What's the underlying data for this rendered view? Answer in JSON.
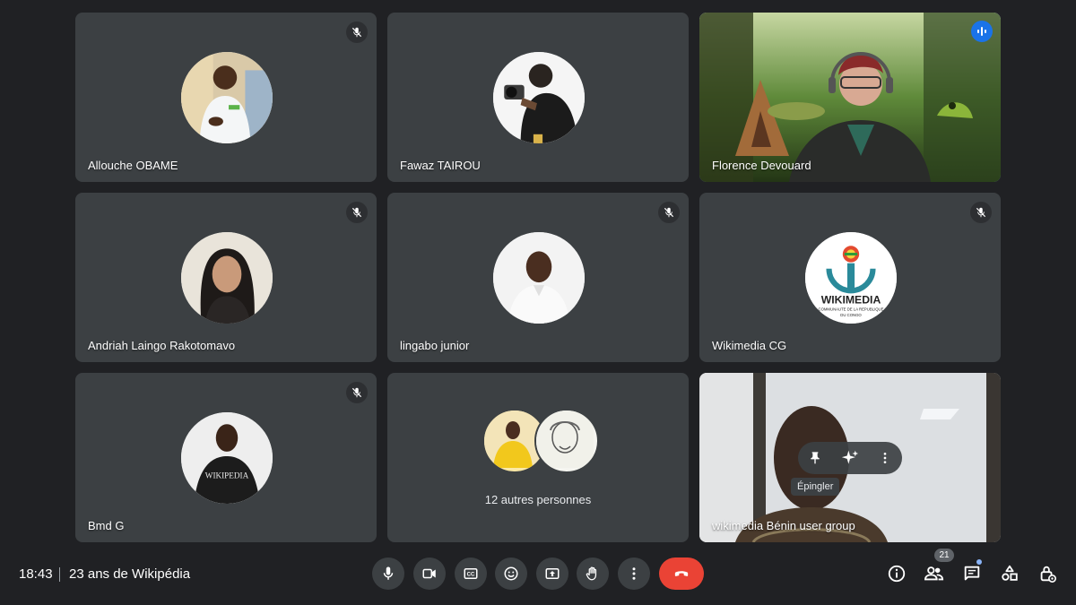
{
  "tiles": [
    {
      "name": "Allouche OBAME"
    },
    {
      "name": "Fawaz TAIROU"
    },
    {
      "name": "Florence Devouard"
    },
    {
      "name": "Andriah Laingo Rakotomavo"
    },
    {
      "name": "lingabo junior"
    },
    {
      "name": "Wikimedia CG"
    },
    {
      "name": "Bmd G"
    },
    {
      "name": "12 autres personnes"
    },
    {
      "name": "wikimedia Bénin user group"
    }
  ],
  "logo": {
    "title": "WIKIMEDIA",
    "subtitle1": "COMMUNAUTE DE LA REPUBLIQUE",
    "subtitle2": "DU CONGO"
  },
  "shirt_text": "WIKIPEDIA",
  "hover": {
    "tooltip": "Épingler"
  },
  "footer": {
    "time": "18:43",
    "meeting_name": "23 ans de Wikipédia",
    "participants_count": "21"
  },
  "colors": {
    "background": "#202124",
    "tile": "#3c4043",
    "hangup": "#ea4335",
    "active_speaker": "#8ab4f8",
    "speaking_badge": "#1a73e8"
  },
  "icons": [
    "mic-off-icon",
    "speaking-icon",
    "mic-icon",
    "camera-icon",
    "captions-icon",
    "emoji-icon",
    "present-icon",
    "hand-icon",
    "more-icon",
    "hangup-icon",
    "info-icon",
    "people-icon",
    "chat-icon",
    "activities-icon",
    "host-controls-icon",
    "pin-icon",
    "sparkle-icon"
  ]
}
